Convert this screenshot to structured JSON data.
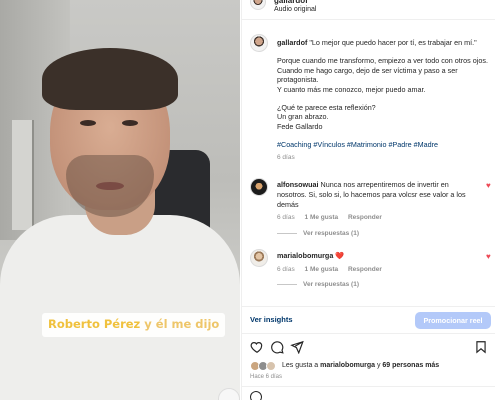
{
  "header": {
    "username": "gallardof",
    "audio_label": "Audio original"
  },
  "caption_overlay": {
    "highlight": "Roberto Pérez",
    "rest": " y él me dijo"
  },
  "post": {
    "username": "gallardof",
    "first_line": "\"Lo mejor que puedo hacer por tí, es trabajar en mí.\"",
    "p1": "Porque cuando me transformo, empiezo a ver todo con otros ojos.",
    "p2": "Cuando me hago cargo, dejo de ser víctima y paso a ser protagonista.",
    "p3": "Y cuanto más me conozco, mejor puedo amar.",
    "p4": "¿Qué te parece esta reflexión?",
    "p5": "Un gran abrazo.",
    "p6": "Fede Gallardo",
    "tags": "#Coaching #Vínculos #Matrimonio #Padre #Madre",
    "time": "6 días"
  },
  "comments": [
    {
      "username": "alfonsowuai",
      "text": "Nunca nos arrepentiremos de invertir en nosotros. Si, solo si, lo hacemos para volcsr ese valor a los demás",
      "time": "6 días",
      "likes": "1 Me gusta",
      "reply": "Responder",
      "replies": "Ver respuestas (1)"
    },
    {
      "username": "marialobomurga",
      "text": "❤️",
      "time": "6 días",
      "likes": "1 Me gusta",
      "reply": "Responder",
      "replies": "Ver respuestas (1)"
    }
  ],
  "insights": {
    "link": "Ver insights",
    "promote": "Promocionar reel"
  },
  "likes": {
    "prefix": "Les gusta a ",
    "user": "marialobomurga",
    "mid": " y ",
    "count": "69 personas más"
  },
  "posted_ago": "Hace 6 días",
  "colors": {
    "link": "#00376b",
    "heart": "#ed4956",
    "promote": "#b3c9f9",
    "muted": "#8e8e8e"
  },
  "icons": [
    "heart-icon",
    "comment-icon",
    "share-icon",
    "save-icon",
    "emoji-icon"
  ]
}
